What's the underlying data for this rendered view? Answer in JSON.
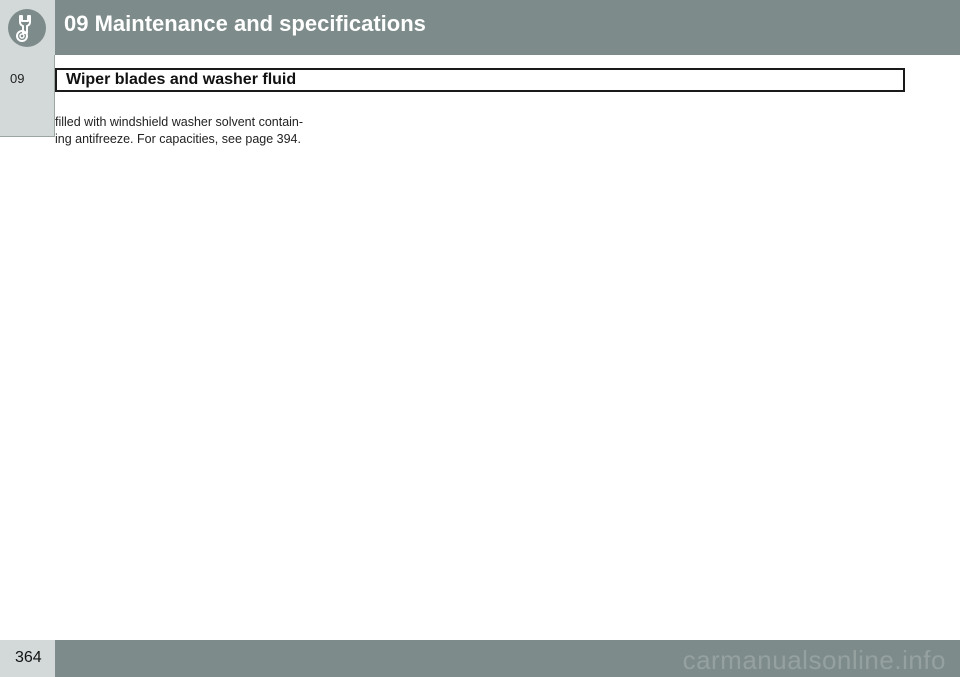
{
  "header": {
    "title": "09 Maintenance and specifications",
    "icon": "wrench-gear-icon"
  },
  "side_tab": {
    "label": "09"
  },
  "section": {
    "title": "Wiper blades and washer fluid"
  },
  "body": {
    "lines": [
      "filled with windshield washer solvent contain-",
      "ing antifreeze. For capacities, see page 394."
    ]
  },
  "footer": {
    "page_number": "364",
    "watermark": "carmanualsonline.info"
  },
  "colors": {
    "header_bg": "#7d8b8a",
    "tab_bg": "#d3d9d9",
    "text": "#222222"
  }
}
